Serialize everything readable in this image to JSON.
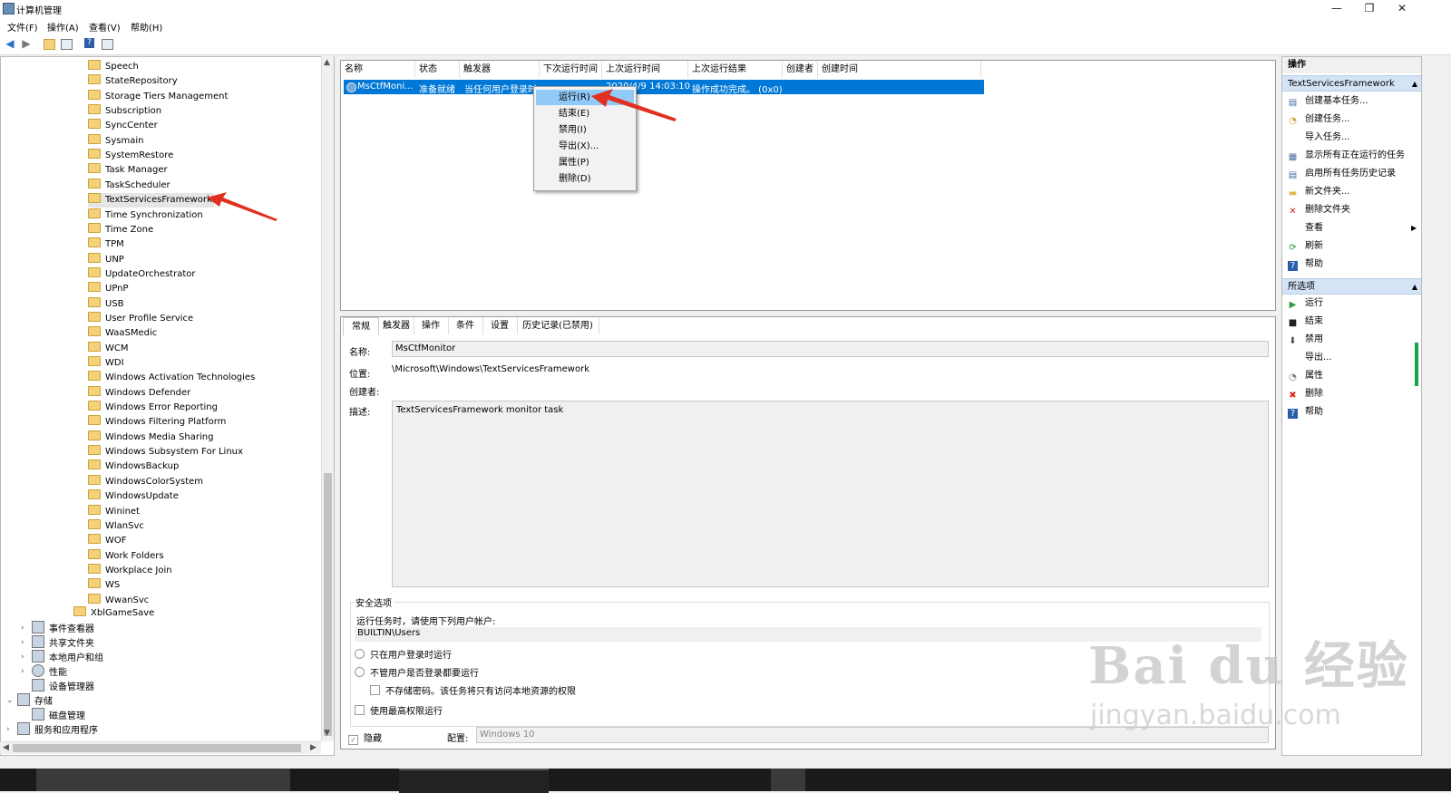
{
  "window": {
    "title": "计算机管理",
    "controls": {
      "minimize": "—",
      "maximize": "❐",
      "close": "✕"
    }
  },
  "menubar": [
    "文件(F)",
    "操作(A)",
    "查看(V)",
    "帮助(H)"
  ],
  "tree": {
    "folders": [
      "Speech",
      "StateRepository",
      "Storage Tiers Management",
      "Subscription",
      "SyncCenter",
      "Sysmain",
      "SystemRestore",
      "Task Manager",
      "TaskScheduler",
      "TextServicesFramework",
      "Time Synchronization",
      "Time Zone",
      "TPM",
      "UNP",
      "UpdateOrchestrator",
      "UPnP",
      "USB",
      "User Profile Service",
      "WaaSMedic",
      "WCM",
      "WDI",
      "Windows Activation Technologies",
      "Windows Defender",
      "Windows Error Reporting",
      "Windows Filtering Platform",
      "Windows Media Sharing",
      "Windows Subsystem For Linux",
      "WindowsBackup",
      "WindowsColorSystem",
      "WindowsUpdate",
      "Wininet",
      "WlanSvc",
      "WOF",
      "Work Folders",
      "Workplace Join",
      "WS",
      "WwanSvc"
    ],
    "selected": "TextServicesFramework",
    "parent_folder": "XblGameSave",
    "nodes": [
      "事件查看器",
      "共享文件夹",
      "本地用户和组",
      "性能",
      "设备管理器"
    ],
    "storage": "存储",
    "disk_mgmt": "磁盘管理",
    "services": "服务和应用程序"
  },
  "tasklist": {
    "columns": [
      "名称",
      "状态",
      "触发器",
      "下次运行时间",
      "上次运行时间",
      "上次运行结果",
      "创建者",
      "创建时间"
    ],
    "row": {
      "name": "MsCtfMoni...",
      "status": "准备就绪",
      "trigger": "当任何用户登录时",
      "last_run": "2020/4/9 14:03:10",
      "last_result": "操作成功完成。 (0x0)"
    }
  },
  "context_menu": [
    "运行(R)",
    "结束(E)",
    "禁用(I)",
    "导出(X)...",
    "属性(P)",
    "删除(D)"
  ],
  "details": {
    "tabs": [
      "常规",
      "触发器",
      "操作",
      "条件",
      "设置",
      "历史记录(已禁用)"
    ],
    "name_label": "名称:",
    "name_value": "MsCtfMonitor",
    "location_label": "位置:",
    "location_value": "\\Microsoft\\Windows\\TextServicesFramework",
    "author_label": "创建者:",
    "desc_label": "描述:",
    "desc_value": "TextServicesFramework monitor task",
    "security_title": "安全选项",
    "run_as_label": "运行任务时，请使用下列用户帐户:",
    "run_as_value": "BUILTIN\\Users",
    "opt_logged_on": "只在用户登录时运行",
    "opt_always": "不管用户是否登录都要运行",
    "opt_no_password": "不存储密码。该任务将只有访问本地资源的权限",
    "opt_highest": "使用最高权限运行",
    "hidden_label": "隐藏",
    "config_label": "配置:",
    "config_value": "Windows 10"
  },
  "actions": {
    "header": "操作",
    "section1": "TextServicesFramework",
    "items1": [
      "创建基本任务...",
      "创建任务...",
      "导入任务...",
      "显示所有正在运行的任务",
      "启用所有任务历史记录",
      "新文件夹...",
      "删除文件夹",
      "查看",
      "刷新",
      "帮助"
    ],
    "section2": "所选项",
    "items2": [
      "运行",
      "结束",
      "禁用",
      "导出...",
      "属性",
      "删除",
      "帮助"
    ]
  },
  "watermark": {
    "logo": "Bai du 经验",
    "url": "jingyan.baidu.com"
  },
  "colors": {
    "selection": "#0078d7",
    "context_highlight": "#91c9f7",
    "annotation_arrow": "#e03020",
    "section_header": "#d4e3f5"
  }
}
